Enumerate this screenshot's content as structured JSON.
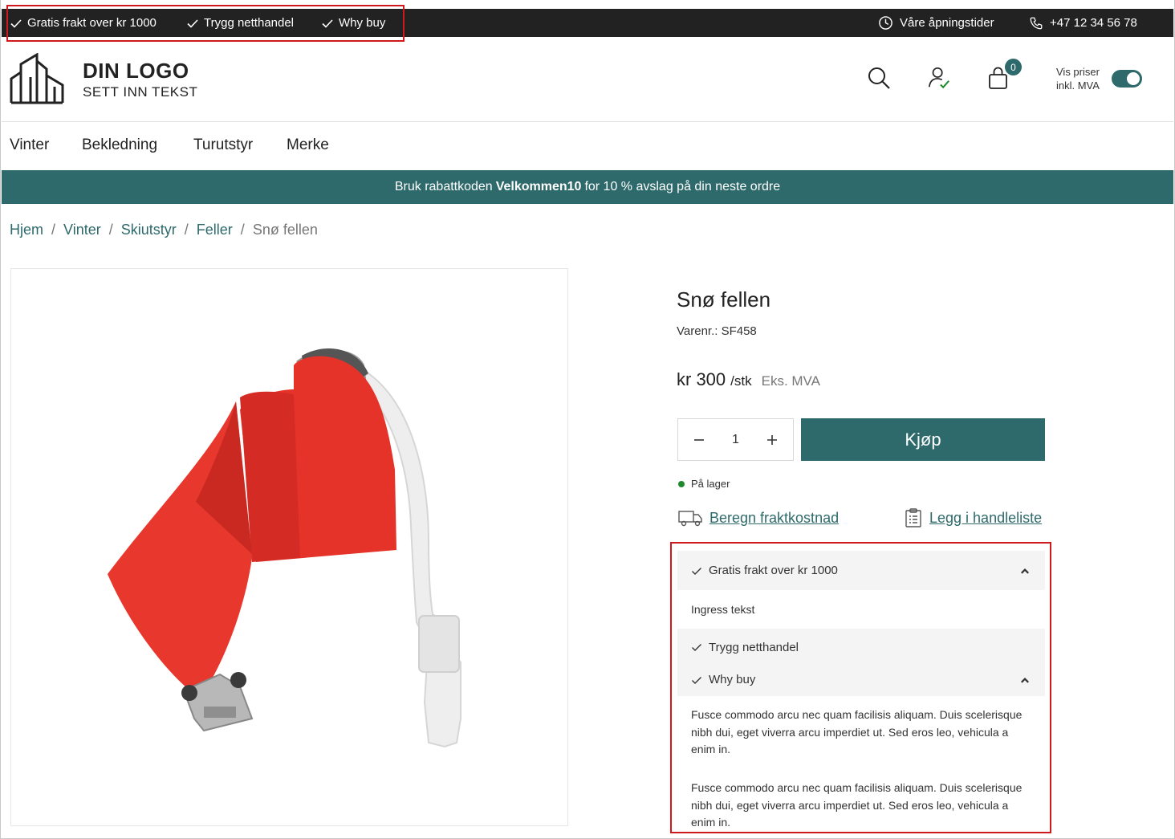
{
  "topbar": {
    "usps": [
      "Gratis frakt over kr 1000",
      "Trygg netthandel",
      "Why buy"
    ],
    "opening_hours": "Våre åpningstider",
    "phone": "+47 12 34 56 78"
  },
  "header": {
    "logo_title": "DIN LOGO",
    "logo_sub": "SETT INN TEKST",
    "cart_count": "0",
    "vat_toggle_label": [
      "Vis priser",
      "inkl. MVA"
    ],
    "vat_toggle_on": true
  },
  "nav": {
    "items": [
      "Vinter",
      "Bekledning",
      "Turutstyr",
      "Merke"
    ]
  },
  "promo": {
    "prefix": "Bruk rabattkoden",
    "code": "Velkommen10",
    "suffix": "for 10 % avslag på din neste ordre"
  },
  "breadcrumb": {
    "items": [
      "Hjem",
      "Vinter",
      "Skiutstyr",
      "Feller"
    ],
    "separator": "/",
    "current": "Snø fellen"
  },
  "product": {
    "title": "Snø fellen",
    "sku": "Varenr.: SF458",
    "price": "kr 300",
    "unit": "/stk",
    "vat_note": "Eks. MVA",
    "quantity": "1",
    "buy_label": "Kjøp",
    "stock": "På lager",
    "shipping_link": "Beregn fraktkostnad",
    "wishlist_link": "Legg i handleliste"
  },
  "accordion": {
    "item1_title": "Gratis frakt over kr 1000",
    "item1_body": "Ingress tekst",
    "item2_title": "Trygg netthandel",
    "item3_title": "Why buy",
    "item3_body_1": "Fusce commodo arcu nec quam facilisis aliquam. Duis scelerisque nibh dui, eget viverra arcu imperdiet ut. Sed eros leo, vehicula a enim in.",
    "item3_body_2": "Fusce commodo arcu nec quam facilisis aliquam. Duis scelerisque nibh dui, eget viverra arcu imperdiet ut. Sed eros leo, vehicula a enim in."
  },
  "colors": {
    "brand": "#2e6a6c",
    "topbar": "#222222",
    "highlight_outline": "#d0191c",
    "in_stock": "#1f8a2d"
  }
}
